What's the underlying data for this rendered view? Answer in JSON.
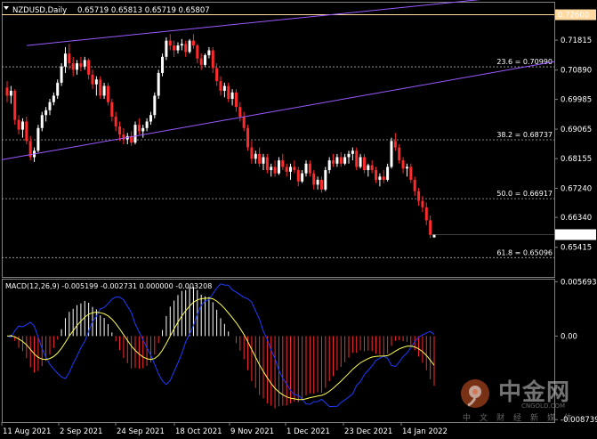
{
  "header": {
    "symbol": "NZDUSD,Daily",
    "ohlc": "0.65719 0.65813 0.65719 0.65807"
  },
  "macd": {
    "label": "MACD(12,26,9) -0.005199 -0.002731 0.000000 -0.003208"
  },
  "price_axis": {
    "labels": [
      "0.71815",
      "0.70890",
      "0.69985",
      "0.69065",
      "0.68155",
      "0.67240",
      "0.66340",
      "0.65415"
    ],
    "current": "0.65807",
    "line_level": "0.72600"
  },
  "macd_axis": {
    "labels": [
      "0.005693",
      "0.00",
      "-0.008739"
    ]
  },
  "fib_levels": [
    {
      "label": "23.6 = 0.70990"
    },
    {
      "label": "38.2 = 0.68737"
    },
    {
      "label": "50.0 = 0.66917"
    },
    {
      "label": "61.8 = 0.65096"
    }
  ],
  "time_axis": {
    "labels": [
      "11 Aug 2021",
      "2 Sep 2021",
      "24 Sep 2021",
      "18 Oct 2021",
      "9 Nov 2021",
      "1 Dec 2021",
      "23 Dec 2021",
      "14 Jan 2022"
    ]
  },
  "watermark": {
    "name": "中金网",
    "url": "CNGOLD.COM",
    "sub": "中文财经新媒体"
  },
  "colors": {
    "bull": "#ffffff",
    "bear": "#ff2a2a",
    "channel": "#9b59ff",
    "fib": "#b0b0b0",
    "hline": "#ffd9a0",
    "macd_line": "#1e3cff",
    "signal_line": "#ffff55",
    "current_bg": "#ffffff",
    "level_bg": "#ffd9a0"
  },
  "chart_data": {
    "type": "candlestick",
    "symbol": "NZDUSD",
    "timeframe": "Daily",
    "ylim": [
      0.645,
      0.73
    ],
    "candles": [
      [
        0.7035,
        0.7055,
        0.699,
        0.701
      ],
      [
        0.701,
        0.704,
        0.6985,
        0.7025
      ],
      [
        0.7025,
        0.703,
        0.692,
        0.6935
      ],
      [
        0.6935,
        0.695,
        0.689,
        0.6905
      ],
      [
        0.6905,
        0.694,
        0.688,
        0.693
      ],
      [
        0.693,
        0.6945,
        0.686,
        0.687
      ],
      [
        0.687,
        0.6885,
        0.681,
        0.682
      ],
      [
        0.682,
        0.685,
        0.6805,
        0.684
      ],
      [
        0.684,
        0.692,
        0.6835,
        0.691
      ],
      [
        0.691,
        0.696,
        0.69,
        0.695
      ],
      [
        0.695,
        0.6975,
        0.693,
        0.6965
      ],
      [
        0.6965,
        0.7,
        0.695,
        0.699
      ],
      [
        0.699,
        0.702,
        0.698,
        0.701
      ],
      [
        0.701,
        0.706,
        0.7,
        0.705
      ],
      [
        0.705,
        0.711,
        0.704,
        0.71
      ],
      [
        0.71,
        0.716,
        0.708,
        0.714
      ],
      [
        0.714,
        0.717,
        0.709,
        0.711
      ],
      [
        0.711,
        0.713,
        0.707,
        0.709
      ],
      [
        0.709,
        0.712,
        0.7075,
        0.711
      ],
      [
        0.711,
        0.713,
        0.7085,
        0.71
      ],
      [
        0.71,
        0.713,
        0.709,
        0.712
      ],
      [
        0.712,
        0.7125,
        0.706,
        0.7075
      ],
      [
        0.7075,
        0.709,
        0.703,
        0.7045
      ],
      [
        0.7045,
        0.707,
        0.701,
        0.706
      ],
      [
        0.706,
        0.707,
        0.7,
        0.701
      ],
      [
        0.701,
        0.705,
        0.7,
        0.704
      ],
      [
        0.704,
        0.705,
        0.698,
        0.699
      ],
      [
        0.699,
        0.7,
        0.693,
        0.6945
      ],
      [
        0.6945,
        0.696,
        0.69,
        0.6915
      ],
      [
        0.6915,
        0.693,
        0.687,
        0.689
      ],
      [
        0.689,
        0.691,
        0.686,
        0.6875
      ],
      [
        0.6875,
        0.6895,
        0.686,
        0.6885
      ],
      [
        0.6885,
        0.69,
        0.6855,
        0.6865
      ],
      [
        0.6865,
        0.693,
        0.686,
        0.692
      ],
      [
        0.692,
        0.694,
        0.689,
        0.69
      ],
      [
        0.69,
        0.692,
        0.688,
        0.691
      ],
      [
        0.691,
        0.694,
        0.69,
        0.693
      ],
      [
        0.693,
        0.696,
        0.692,
        0.695
      ],
      [
        0.695,
        0.702,
        0.694,
        0.701
      ],
      [
        0.701,
        0.709,
        0.7,
        0.708
      ],
      [
        0.708,
        0.714,
        0.707,
        0.713
      ],
      [
        0.713,
        0.719,
        0.712,
        0.718
      ],
      [
        0.718,
        0.72,
        0.715,
        0.7165
      ],
      [
        0.7165,
        0.718,
        0.713,
        0.715
      ],
      [
        0.715,
        0.7175,
        0.714,
        0.7165
      ],
      [
        0.7165,
        0.7185,
        0.715,
        0.717
      ],
      [
        0.717,
        0.718,
        0.713,
        0.7145
      ],
      [
        0.7145,
        0.7185,
        0.714,
        0.718
      ],
      [
        0.718,
        0.72,
        0.7155,
        0.7165
      ],
      [
        0.7165,
        0.717,
        0.711,
        0.7125
      ],
      [
        0.7125,
        0.714,
        0.709,
        0.7105
      ],
      [
        0.7105,
        0.714,
        0.71,
        0.7135
      ],
      [
        0.7135,
        0.716,
        0.7125,
        0.715
      ],
      [
        0.715,
        0.716,
        0.708,
        0.7095
      ],
      [
        0.7095,
        0.711,
        0.704,
        0.7055
      ],
      [
        0.7055,
        0.707,
        0.701,
        0.7025
      ],
      [
        0.7025,
        0.705,
        0.7005,
        0.704
      ],
      [
        0.704,
        0.705,
        0.699,
        0.7
      ],
      [
        0.7,
        0.703,
        0.698,
        0.702
      ],
      [
        0.702,
        0.703,
        0.696,
        0.6975
      ],
      [
        0.6975,
        0.699,
        0.693,
        0.6945
      ],
      [
        0.6945,
        0.696,
        0.69,
        0.691
      ],
      [
        0.691,
        0.692,
        0.684,
        0.685
      ],
      [
        0.685,
        0.687,
        0.68,
        0.6815
      ],
      [
        0.6815,
        0.684,
        0.68,
        0.683
      ],
      [
        0.683,
        0.685,
        0.679,
        0.68
      ],
      [
        0.68,
        0.683,
        0.678,
        0.682
      ],
      [
        0.682,
        0.683,
        0.677,
        0.678
      ],
      [
        0.678,
        0.68,
        0.676,
        0.679
      ],
      [
        0.679,
        0.681,
        0.676,
        0.677
      ],
      [
        0.677,
        0.682,
        0.6765,
        0.681
      ],
      [
        0.681,
        0.683,
        0.678,
        0.679
      ],
      [
        0.679,
        0.68,
        0.676,
        0.6775
      ],
      [
        0.6775,
        0.68,
        0.675,
        0.679
      ],
      [
        0.679,
        0.681,
        0.677,
        0.678
      ],
      [
        0.678,
        0.679,
        0.673,
        0.6745
      ],
      [
        0.6745,
        0.678,
        0.674,
        0.677
      ],
      [
        0.677,
        0.681,
        0.676,
        0.68
      ],
      [
        0.68,
        0.681,
        0.676,
        0.677
      ],
      [
        0.677,
        0.678,
        0.672,
        0.6735
      ],
      [
        0.6735,
        0.676,
        0.672,
        0.675
      ],
      [
        0.675,
        0.676,
        0.671,
        0.672
      ],
      [
        0.672,
        0.679,
        0.6715,
        0.678
      ],
      [
        0.678,
        0.682,
        0.677,
        0.681
      ],
      [
        0.681,
        0.683,
        0.679,
        0.68
      ],
      [
        0.68,
        0.683,
        0.679,
        0.682
      ],
      [
        0.682,
        0.6835,
        0.679,
        0.68
      ],
      [
        0.68,
        0.683,
        0.6795,
        0.682
      ],
      [
        0.682,
        0.684,
        0.68,
        0.683
      ],
      [
        0.683,
        0.685,
        0.681,
        0.684
      ],
      [
        0.684,
        0.685,
        0.678,
        0.679
      ],
      [
        0.679,
        0.683,
        0.6785,
        0.682
      ],
      [
        0.682,
        0.683,
        0.677,
        0.678
      ],
      [
        0.678,
        0.68,
        0.676,
        0.6795
      ],
      [
        0.6795,
        0.681,
        0.677,
        0.678
      ],
      [
        0.678,
        0.679,
        0.674,
        0.675
      ],
      [
        0.675,
        0.677,
        0.673,
        0.676
      ],
      [
        0.676,
        0.678,
        0.674,
        0.675
      ],
      [
        0.675,
        0.68,
        0.6745,
        0.679
      ],
      [
        0.679,
        0.688,
        0.6785,
        0.687
      ],
      [
        0.687,
        0.6895,
        0.684,
        0.685
      ],
      [
        0.685,
        0.686,
        0.68,
        0.681
      ],
      [
        0.681,
        0.682,
        0.677,
        0.6785
      ],
      [
        0.6785,
        0.68,
        0.676,
        0.679
      ],
      [
        0.679,
        0.68,
        0.674,
        0.675
      ],
      [
        0.675,
        0.676,
        0.67,
        0.6715
      ],
      [
        0.6715,
        0.6725,
        0.667,
        0.6685
      ],
      [
        0.6685,
        0.67,
        0.665,
        0.6665
      ],
      [
        0.6665,
        0.668,
        0.661,
        0.6625
      ],
      [
        0.6625,
        0.664,
        0.657,
        0.658
      ],
      [
        0.65719,
        0.65813,
        0.65719,
        0.65807
      ]
    ],
    "macd_ylim": [
      -0.009,
      0.006
    ],
    "macd_hist_first_last": [
      -0.0005,
      -0.003208
    ]
  }
}
